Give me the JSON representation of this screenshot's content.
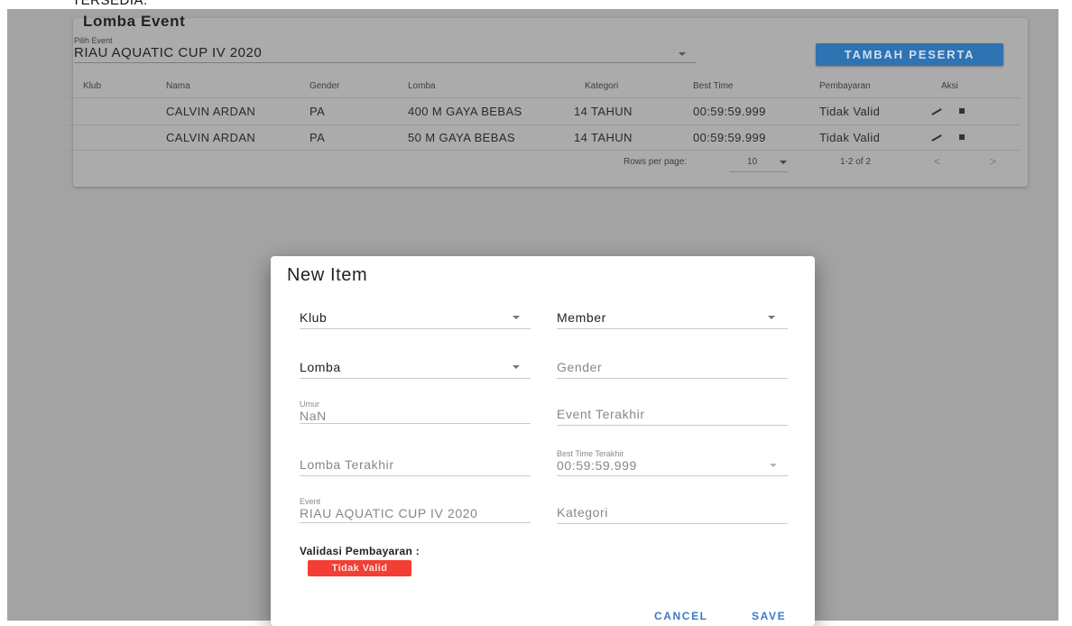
{
  "top_cut_text": "TERSEDIA.",
  "card": {
    "title": "Lomba Event",
    "event_label": "Pilih Event",
    "event_value": "RIAU AQUATIC CUP IV 2020",
    "add_button": "TAMBAH PESERTA"
  },
  "table": {
    "headers": [
      "Klub",
      "Nama",
      "Gender",
      "Lomba",
      "Kategori",
      "Best Time",
      "Pembayaran",
      "Aksi"
    ],
    "rows": [
      {
        "klub": "",
        "nama": "CALVIN ARDAN",
        "gender": "PA",
        "lomba": "400 M GAYA BEBAS",
        "kategori": "14 TAHUN",
        "best_time": "00:59:59.999",
        "pembayaran": "Tidak Valid"
      },
      {
        "klub": "",
        "nama": "CALVIN ARDAN",
        "gender": "PA",
        "lomba": "50 M GAYA BEBAS",
        "kategori": "14 TAHUN",
        "best_time": "00:59:59.999",
        "pembayaran": "Tidak Valid"
      }
    ],
    "footer": {
      "rows_per_page_label": "Rows per page:",
      "rows_per_page_value": "10",
      "range": "1-2 of 2",
      "prev": "<",
      "next": ">"
    }
  },
  "dialog": {
    "title": "New Item",
    "klub_label": "Klub",
    "member_label": "Member",
    "lomba_label": "Lomba",
    "gender_label": "Gender",
    "umur_label": "Umur",
    "umur_value": "NaN",
    "event_terakhir_label": "Event Terakhir",
    "lomba_terakhir_label": "Lomba Terakhir",
    "best_time_terakhir_label": "Best Time Terakhir",
    "best_time_terakhir_value": "00:59:59.999",
    "event_label": "Event",
    "event_value": "RIAU AQUATIC CUP IV 2020",
    "kategori_label": "Kategori",
    "validasi_label": "Validasi Pembayaran :",
    "validasi_button": "Tidak Valid",
    "cancel_button": "CANCEL",
    "save_button": "SAVE"
  },
  "colors": {
    "primary_button": "#2e73b2",
    "danger_button": "#f23e34",
    "dialog_action": "#3a7bc6",
    "overlay": "#a3a3a3"
  }
}
